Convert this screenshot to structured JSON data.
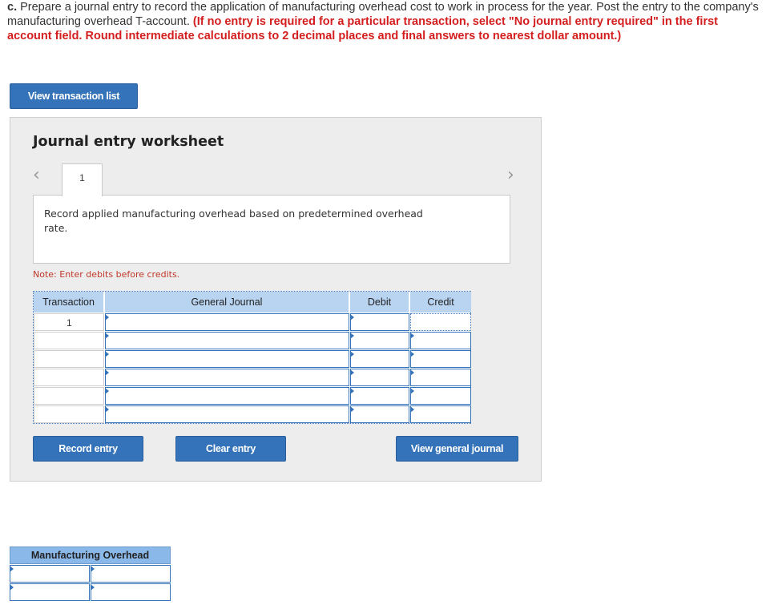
{
  "instructions": {
    "prefix": "c.",
    "text": " Prepare a journal entry to record the application of manufacturing overhead cost to work in process for the year. Post the entry to the company's manufacturing overhead T-account. ",
    "emphasis": "(If no entry is required for a particular transaction, select \"No journal entry required\" in the first account field. Round intermediate calculations to 2 decimal places and final answers to nearest dollar amount.)"
  },
  "buttons": {
    "view_transaction_list": "View transaction list",
    "record_entry": "Record entry",
    "clear_entry": "Clear entry",
    "view_general_journal": "View general journal"
  },
  "worksheet": {
    "title": "Journal entry worksheet",
    "tab_label": "1",
    "prev_icon": "chevron-left-icon",
    "next_icon": "chevron-right-icon",
    "description": "Record applied manufacturing overhead based on predetermined overhead rate.",
    "note": "Note: Enter debits before credits."
  },
  "journal": {
    "headers": [
      "Transaction",
      "General Journal",
      "Debit",
      "Credit"
    ],
    "rows": [
      {
        "transaction": "1",
        "account": "",
        "debit": "",
        "credit": ""
      },
      {
        "transaction": "",
        "account": "",
        "debit": "",
        "credit": ""
      },
      {
        "transaction": "",
        "account": "",
        "debit": "",
        "credit": ""
      },
      {
        "transaction": "",
        "account": "",
        "debit": "",
        "credit": ""
      },
      {
        "transaction": "",
        "account": "",
        "debit": "",
        "credit": ""
      },
      {
        "transaction": "",
        "account": "",
        "debit": "",
        "credit": ""
      }
    ]
  },
  "t_account": {
    "title": "Manufacturing Overhead",
    "rows": [
      {
        "debit": "",
        "credit": ""
      },
      {
        "debit": "",
        "credit": ""
      }
    ]
  },
  "colors": {
    "accent": "#3473b9",
    "header_blue": "#b9d4f1",
    "t_header_blue": "#8ab8e8",
    "panel_bg": "#ededed",
    "instruction_red": "#d41e1e"
  }
}
